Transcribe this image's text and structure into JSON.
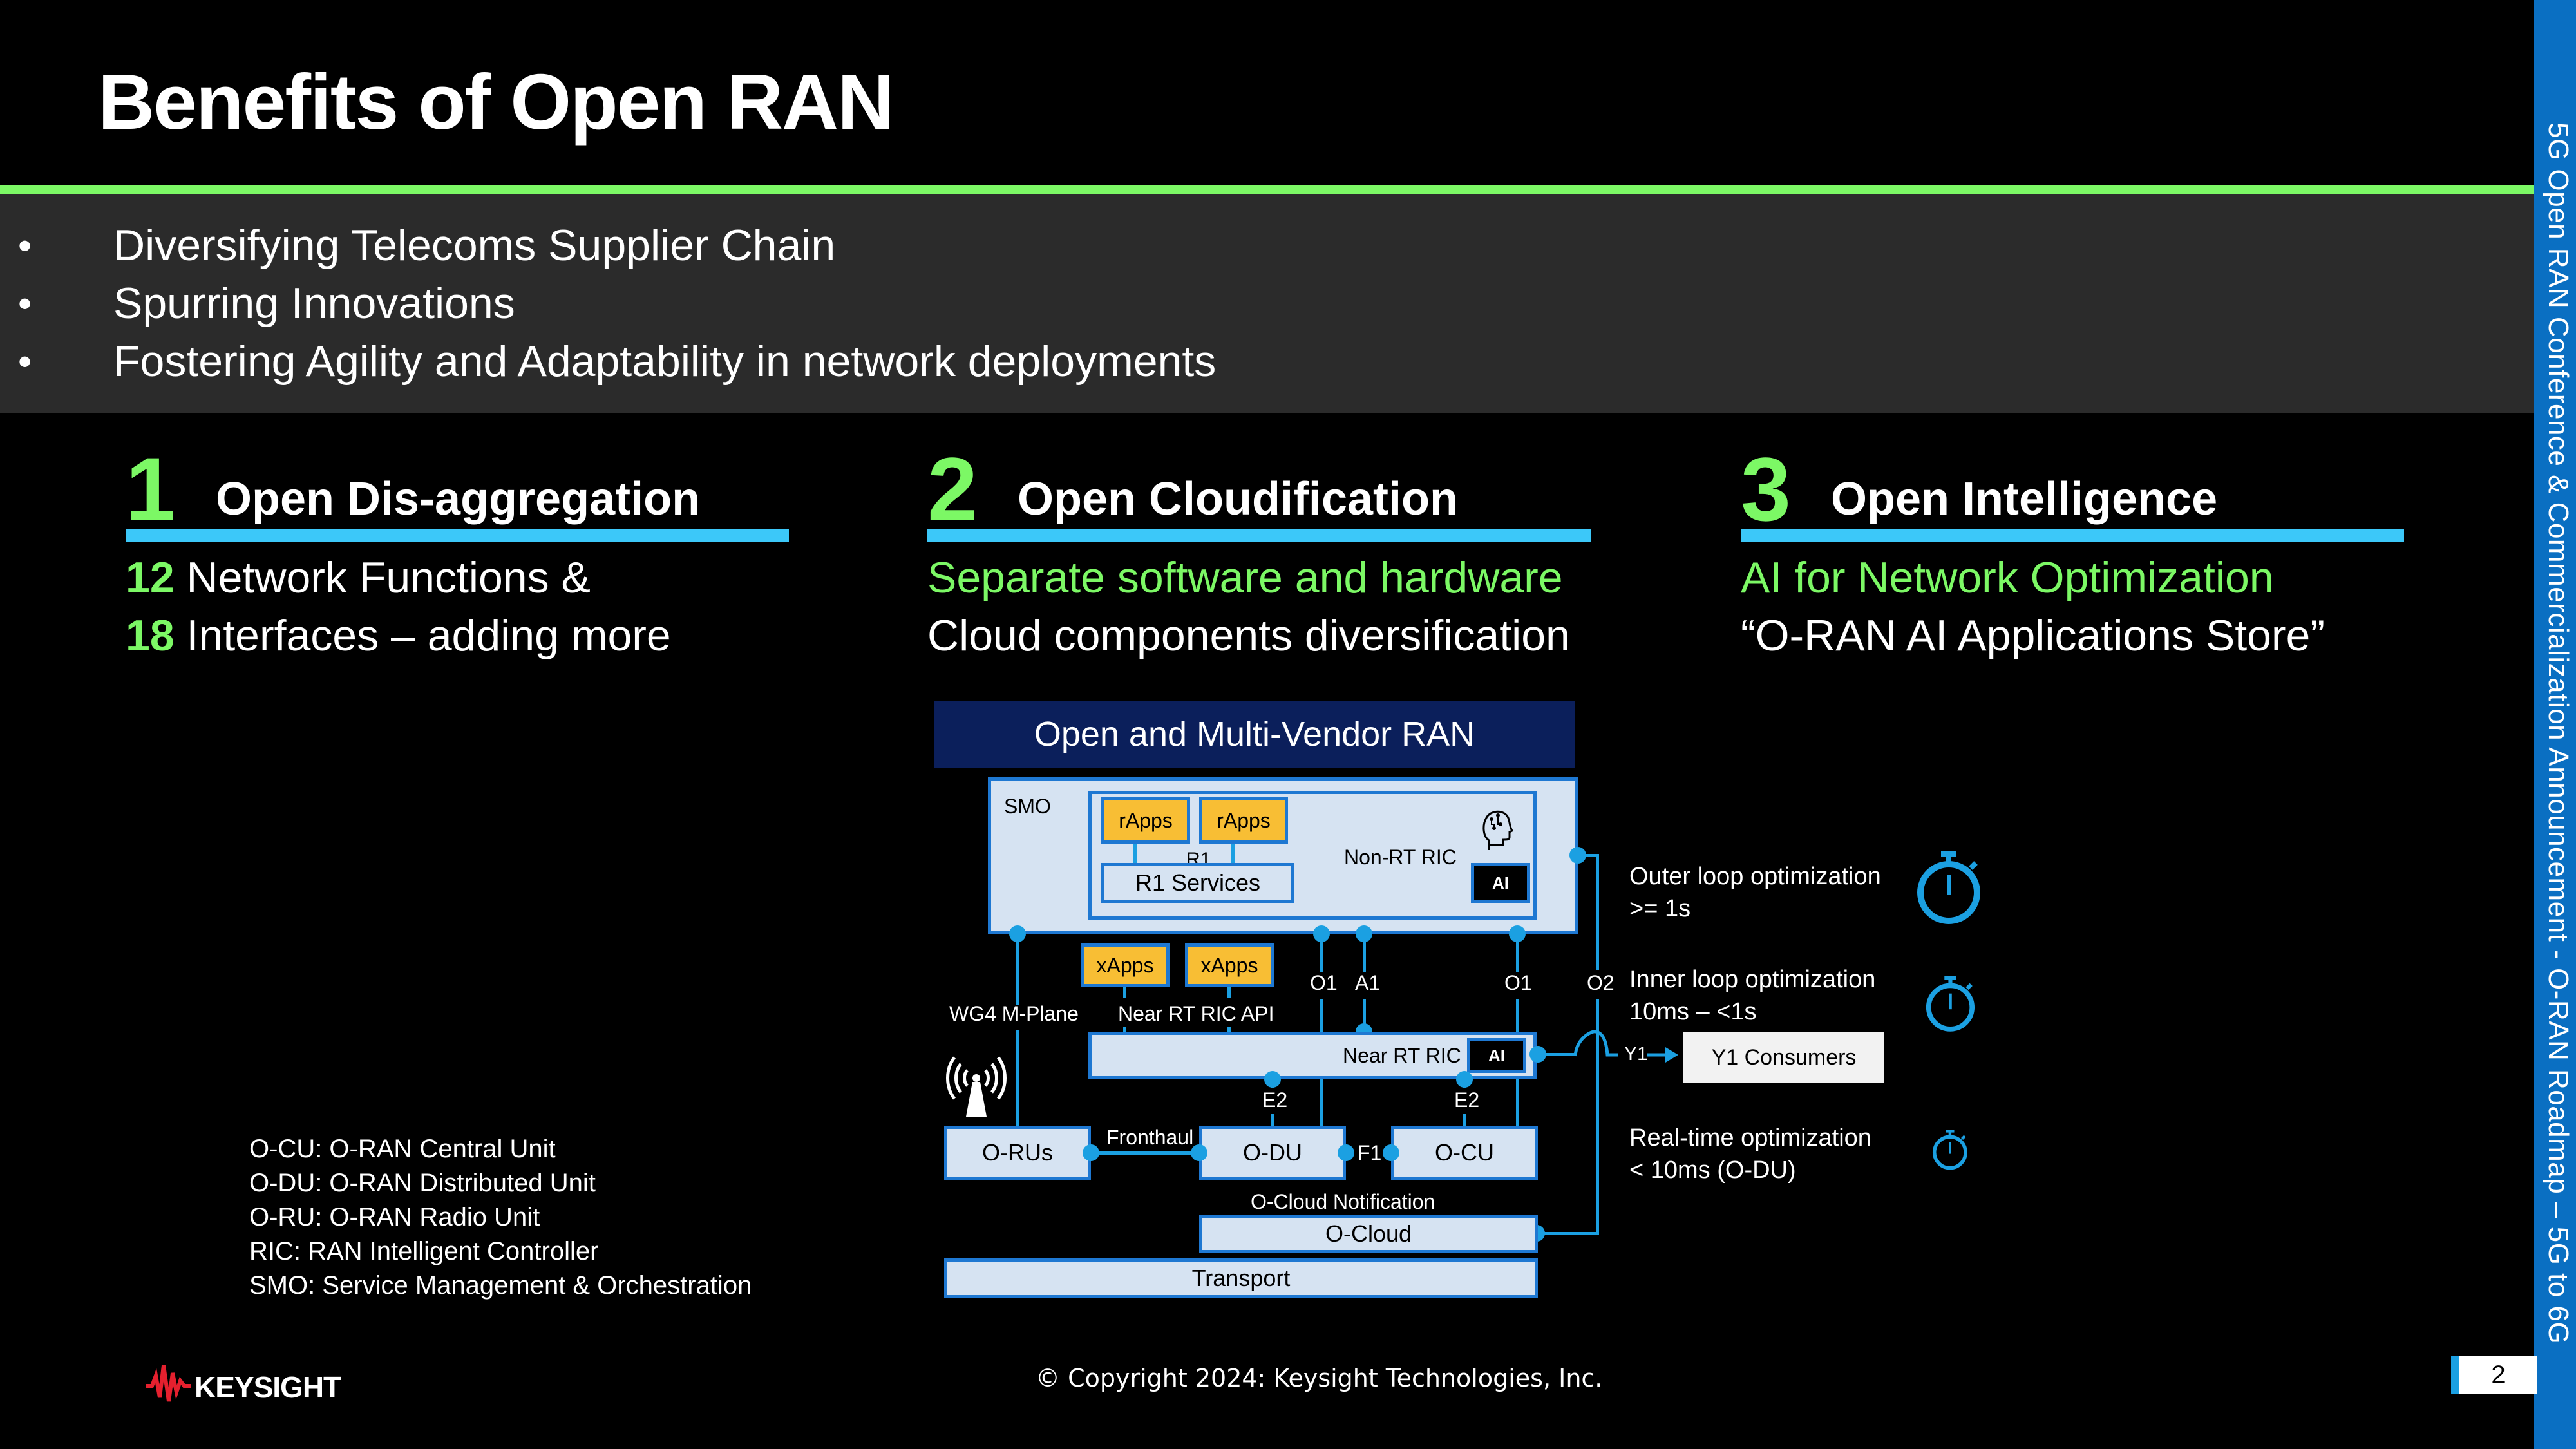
{
  "title": "Benefits of Open RAN",
  "bullets": [
    "Diversifying  Telecoms Supplier Chain",
    "Spurring Innovations",
    "Fostering Agility and Adaptability in network deployments"
  ],
  "bullet_glyph": "•",
  "sidebar_text": "5G Open RAN Conference & Commercialization Announcement - O-RAN Roadmap – 5G to 6G",
  "pillars": [
    {
      "number": "1",
      "heading": "Open Dis-aggregation",
      "line1_num": "12",
      "line1_text": " Network Functions &",
      "line2_num": "18",
      "line2_text": " Interfaces – adding more"
    },
    {
      "number": "2",
      "heading": "Open Cloudification",
      "line1": "Separate software and hardware",
      "line2": "Cloud components diversification"
    },
    {
      "number": "3",
      "heading": "Open Intelligence",
      "line1": "AI for Network Optimization",
      "line2": "“O-RAN AI Applications Store”"
    }
  ],
  "diagram": {
    "banner": "Open and Multi-Vendor RAN",
    "smo": "SMO",
    "rapps": [
      "rApps",
      "rApps"
    ],
    "r1": "R1",
    "r1_services": "R1 Services",
    "non_rt_ric": "Non-RT RIC",
    "ai": "AI",
    "xapps": [
      "xApps",
      "xApps"
    ],
    "interfaces": {
      "o1_left": "O1",
      "a1": "A1",
      "o1_right": "O1",
      "o2": "O2",
      "wg4": "WG4 M-Plane",
      "near_rt_api": "Near RT RIC API",
      "e2_left": "E2",
      "e2_right": "E2",
      "fronthaul": "Fronthaul",
      "f1": "F1",
      "y1": "Y1",
      "ocloud_notification": "O-Cloud Notification"
    },
    "near_rt_ric": "Near RT RIC",
    "o_rus": "O-RUs",
    "o_du": "O-DU",
    "o_cu": "O-CU",
    "o_cloud": "O-Cloud",
    "transport": "Transport",
    "y1_consumers": "Y1 Consumers",
    "icons": {
      "brain": "brain-circuit-icon",
      "antenna": "radio-tower-icon",
      "timer": "stopwatch-icon"
    },
    "colors": {
      "link": "#1BA0E2",
      "box_fill": "#D6E3F2",
      "app_fill": "#F8BE34",
      "banner": "#0B1F5B"
    }
  },
  "optimizations": [
    {
      "line1": "Outer loop optimization",
      "line2": ">= 1s"
    },
    {
      "line1": "Inner loop optimization",
      "line2": "10ms – <1s"
    },
    {
      "line1": "Real-time optimization",
      "line2": "< 10ms (O-DU)"
    }
  ],
  "legend": [
    "O-CU: O-RAN Central Unit",
    "O-DU: O-RAN Distributed Unit",
    "O-RU: O-RAN Radio Unit",
    "RIC: RAN Intelligent Controller",
    "SMO: Service Management & Orchestration"
  ],
  "footer": {
    "logo_text": "KEYSIGHT",
    "copyright": "© Copyright 2024: Keysight Technologies, Inc.",
    "page_number": "2"
  },
  "colors": {
    "accent_green": "#7CF865",
    "accent_blue": "#3CC8F9",
    "sidebar_blue": "#0A6FC2",
    "logo_red": "#E5202E"
  }
}
